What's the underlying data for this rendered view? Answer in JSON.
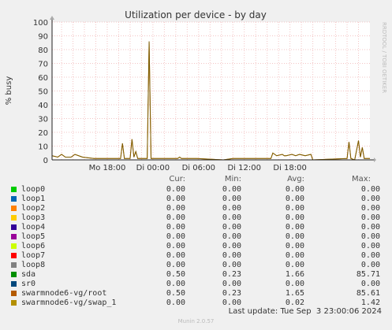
{
  "chart_data": {
    "type": "line",
    "title": "Utilization per device - by day",
    "ylabel": "% busy",
    "ylim": [
      0,
      100
    ],
    "yticks": [
      0,
      10,
      20,
      30,
      40,
      50,
      60,
      70,
      80,
      90,
      100
    ],
    "xticks": [
      "Mo 18:00",
      "Di 00:00",
      "Di 06:00",
      "Di 12:00",
      "Di 18:00"
    ],
    "side_label": "RRDTOOL / TOBI OETIKER",
    "grid": true,
    "series": [
      {
        "name": "sda",
        "color": "#cc7700",
        "points": [
          [
            0,
            3
          ],
          [
            3,
            2
          ],
          [
            5,
            4
          ],
          [
            7,
            2
          ],
          [
            10,
            2
          ],
          [
            12,
            4
          ],
          [
            14,
            3
          ],
          [
            16,
            2
          ],
          [
            22,
            1
          ],
          [
            30,
            1
          ],
          [
            36,
            1
          ],
          [
            37,
            12
          ],
          [
            38,
            1
          ],
          [
            41,
            1
          ],
          [
            42,
            15
          ],
          [
            43,
            2
          ],
          [
            44,
            6
          ],
          [
            45,
            1
          ],
          [
            50,
            1
          ],
          [
            51,
            85
          ],
          [
            52,
            1
          ],
          [
            54,
            1
          ],
          [
            55,
            1
          ],
          [
            66,
            1
          ],
          [
            67,
            2
          ],
          [
            68,
            1
          ],
          [
            72,
            1
          ],
          [
            74,
            1
          ],
          [
            76,
            1
          ],
          [
            90,
            0
          ],
          [
            95,
            1
          ],
          [
            100,
            1
          ],
          [
            110,
            1
          ],
          [
            115,
            1
          ],
          [
            116,
            5
          ],
          [
            118,
            3
          ],
          [
            121,
            4
          ],
          [
            122,
            3
          ],
          [
            123,
            3
          ],
          [
            126,
            4
          ],
          [
            128,
            3
          ],
          [
            130,
            4
          ],
          [
            133,
            3
          ],
          [
            136,
            4
          ],
          [
            137,
            0
          ],
          [
            155,
            1
          ],
          [
            156,
            13
          ],
          [
            157,
            1
          ],
          [
            159,
            0
          ],
          [
            161,
            14
          ],
          [
            162,
            2
          ],
          [
            163,
            9
          ],
          [
            164,
            1
          ],
          [
            167,
            1
          ]
        ]
      },
      {
        "name": "swarmnode6-vg/root",
        "color": "#7a5a00",
        "points": [
          [
            0,
            3
          ],
          [
            3,
            2
          ],
          [
            5,
            4
          ],
          [
            7,
            2
          ],
          [
            10,
            2
          ],
          [
            12,
            4
          ],
          [
            14,
            3
          ],
          [
            16,
            2
          ],
          [
            22,
            1
          ],
          [
            30,
            1
          ],
          [
            36,
            1
          ],
          [
            37,
            12
          ],
          [
            38,
            1
          ],
          [
            41,
            1
          ],
          [
            42,
            15
          ],
          [
            43,
            2
          ],
          [
            44,
            6
          ],
          [
            45,
            1
          ],
          [
            50,
            1
          ],
          [
            51,
            86
          ],
          [
            52,
            1
          ],
          [
            54,
            1
          ],
          [
            55,
            1
          ],
          [
            66,
            1
          ],
          [
            67,
            2
          ],
          [
            68,
            1
          ],
          [
            72,
            1
          ],
          [
            74,
            1
          ],
          [
            76,
            1
          ],
          [
            90,
            0
          ],
          [
            95,
            1
          ],
          [
            100,
            1
          ],
          [
            110,
            1
          ],
          [
            115,
            1
          ],
          [
            116,
            5
          ],
          [
            118,
            3
          ],
          [
            121,
            4
          ],
          [
            122,
            3
          ],
          [
            123,
            3
          ],
          [
            126,
            4
          ],
          [
            128,
            3
          ],
          [
            130,
            4
          ],
          [
            133,
            3
          ],
          [
            136,
            4
          ],
          [
            137,
            0
          ],
          [
            155,
            1
          ],
          [
            156,
            13
          ],
          [
            157,
            1
          ],
          [
            159,
            0
          ],
          [
            161,
            14
          ],
          [
            162,
            2
          ],
          [
            163,
            9
          ],
          [
            164,
            1
          ],
          [
            167,
            1
          ]
        ]
      }
    ]
  },
  "legend": {
    "headers": {
      "cur": "Cur:",
      "min": "Min:",
      "avg": "Avg:",
      "max": "Max:"
    },
    "rows": [
      {
        "name": "loop0",
        "color": "#00cc00",
        "cur": "0.00",
        "min": "0.00",
        "avg": "0.00",
        "max": "0.00"
      },
      {
        "name": "loop1",
        "color": "#0066b3",
        "cur": "0.00",
        "min": "0.00",
        "avg": "0.00",
        "max": "0.00"
      },
      {
        "name": "loop2",
        "color": "#ff8000",
        "cur": "0.00",
        "min": "0.00",
        "avg": "0.00",
        "max": "0.00"
      },
      {
        "name": "loop3",
        "color": "#ffcc00",
        "cur": "0.00",
        "min": "0.00",
        "avg": "0.00",
        "max": "0.00"
      },
      {
        "name": "loop4",
        "color": "#330099",
        "cur": "0.00",
        "min": "0.00",
        "avg": "0.00",
        "max": "0.00"
      },
      {
        "name": "loop5",
        "color": "#990099",
        "cur": "0.00",
        "min": "0.00",
        "avg": "0.00",
        "max": "0.00"
      },
      {
        "name": "loop6",
        "color": "#ccff00",
        "cur": "0.00",
        "min": "0.00",
        "avg": "0.00",
        "max": "0.00"
      },
      {
        "name": "loop7",
        "color": "#ff0000",
        "cur": "0.00",
        "min": "0.00",
        "avg": "0.00",
        "max": "0.00"
      },
      {
        "name": "loop8",
        "color": "#808080",
        "cur": "0.00",
        "min": "0.00",
        "avg": "0.00",
        "max": "0.00"
      },
      {
        "name": "sda",
        "color": "#008f00",
        "cur": "0.50",
        "min": "0.23",
        "avg": "1.66",
        "max": "85.71"
      },
      {
        "name": "sr0",
        "color": "#00487d",
        "cur": "0.00",
        "min": "0.00",
        "avg": "0.00",
        "max": "0.00"
      },
      {
        "name": "swarmnode6-vg/root",
        "color": "#b35a00",
        "cur": "0.50",
        "min": "0.23",
        "avg": "1.65",
        "max": "85.61"
      },
      {
        "name": "swarmnode6-vg/swap_1",
        "color": "#b38f00",
        "cur": "0.00",
        "min": "0.00",
        "avg": "0.02",
        "max": "1.42"
      }
    ]
  },
  "last_update": "Last update: Tue Sep  3 23:00:06 2024",
  "footer": "Munin 2.0.57"
}
